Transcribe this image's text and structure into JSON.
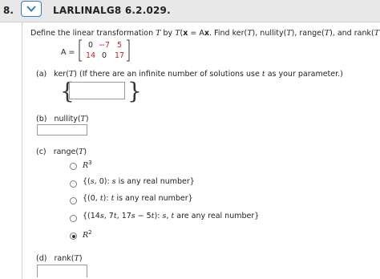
{
  "header": {
    "question_number": "8.",
    "question_id": "LARLINALG8 6.2.029."
  },
  "prompt": {
    "t1": "Define the linear transformation ",
    "T": "T",
    "t2": " by ",
    "x": "x",
    "t3": " = A",
    "xb": "x",
    "t4": ". Find ker(",
    "t5": "), nullity(",
    "t6": "), range(",
    "t7": "), and rank(",
    "t8": ")."
  },
  "matrix": {
    "label": "A =",
    "rows": [
      [
        "0",
        "−7",
        "5"
      ],
      [
        "14",
        "0",
        "17"
      ]
    ]
  },
  "part_a": {
    "letter": "(a)",
    "text1": "ker(",
    "T": "T",
    "text2": ") (If there are an infinite number of solutions use ",
    "t": "t",
    "text3": " as your parameter.)",
    "value": ""
  },
  "part_b": {
    "letter": "(b)",
    "text1": "nullity(",
    "T": "T",
    "text2": ")",
    "value": ""
  },
  "part_c": {
    "letter": "(c)",
    "text1": "range(",
    "T": "T",
    "text2": ")",
    "options": {
      "o1": {
        "base": "R",
        "sup": "3"
      },
      "o2": {
        "a": "{(",
        "s": "s",
        "b": ", 0): ",
        "s2": "s",
        "c": " is any real number}"
      },
      "o3": {
        "a": "{(0, ",
        "t": "t",
        "b": "): ",
        "t2": "t",
        "c": " is any real number}"
      },
      "o4": {
        "a": "{(14",
        "s": "s",
        "b": ", 7",
        "t": "t",
        "c": ", 17",
        "s2": "s",
        "d": " − 5",
        "t2": "t",
        "e": "): ",
        "s3": "s",
        "f": ", ",
        "t3": "t",
        "g": " are any real number}"
      },
      "o5": {
        "base": "R",
        "sup": "2"
      }
    },
    "selected_index": 4
  },
  "part_d": {
    "letter": "(d)",
    "text1": "rank(",
    "T": "T",
    "text2": ")"
  }
}
